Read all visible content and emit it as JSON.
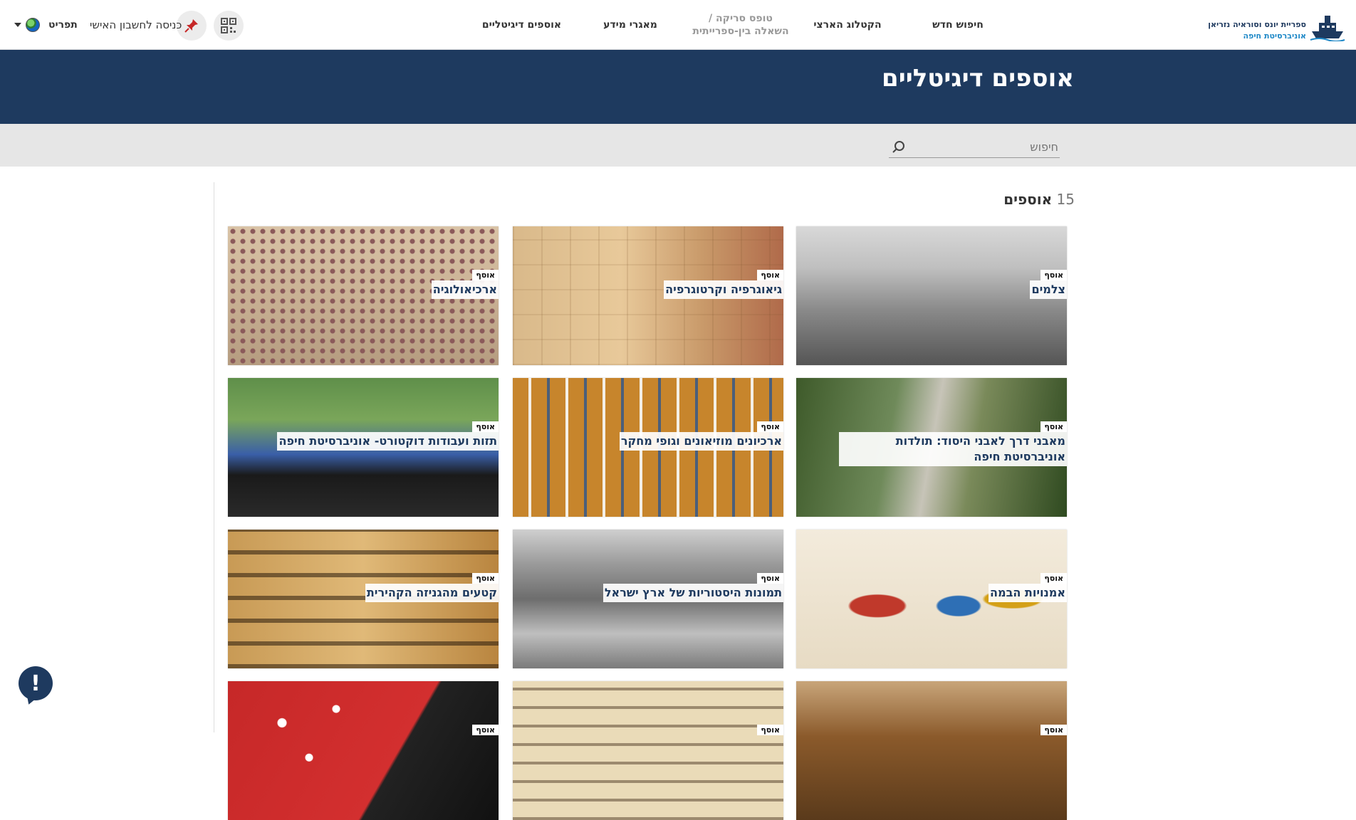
{
  "header": {
    "logo_line1": "ספריית יונס וסוראיה נזריאן",
    "logo_line2": "אוניברסיטת חיפה",
    "nav": [
      {
        "label": "חיפוש חדש"
      },
      {
        "label": "הקטלוג הארצי"
      },
      {
        "label_line1": "טופס סריקה /",
        "label_line2": "השאלה בין-ספרייתית"
      },
      {
        "label": "מאגרי מידע"
      },
      {
        "label": "אוספים דיגיטליים"
      }
    ],
    "login_label": "כניסה לחשבון האישי",
    "menu_label": "תפריט"
  },
  "banner": {
    "title": "אוספים דיגיטליים"
  },
  "search": {
    "placeholder": "חיפוש",
    "value": ""
  },
  "results": {
    "count": "15",
    "count_word": "אוספים"
  },
  "collections": [
    {
      "badge": "אוסף",
      "title": "צלמים",
      "image": "photographers"
    },
    {
      "badge": "אוסף",
      "title": "גיאוגרפיה וקרטוגרפיה",
      "image": "map"
    },
    {
      "badge": "אוסף",
      "title": "ארכיאולוגיה",
      "image": "mosaic"
    },
    {
      "badge": "אוסף",
      "title": "מאבני דרך לאבני היסוד: תולדות אוניברסיטת חיפה",
      "image": "aerial"
    },
    {
      "badge": "אוסף",
      "title": "ארכיונים מוזיאונים וגופי מחקר",
      "image": "archive"
    },
    {
      "badge": "אוסף",
      "title": "תזות ועבודות דוקטורט- אוניברסיטת חיפה",
      "image": "graduation"
    },
    {
      "badge": "אוסף",
      "title": "אמנויות הבמה",
      "image": "theater"
    },
    {
      "badge": "אוסף",
      "title": "תמונות היסטוריות של ארץ ישראל",
      "image": "jerusalem"
    },
    {
      "badge": "אוסף",
      "title": "קטעים מהגניזה הקהירית",
      "image": "geniza"
    },
    {
      "badge": "אוסף",
      "title": "",
      "image": "books"
    },
    {
      "badge": "אוסף",
      "title": "",
      "image": "manuscript"
    },
    {
      "badge": "אוסף",
      "title": "",
      "image": "cinema"
    }
  ],
  "feedback_symbol": "!",
  "colors": {
    "primary": "#1e3a5f",
    "search_band": "#e6e6e6",
    "accent_blue": "#1e88c7"
  }
}
